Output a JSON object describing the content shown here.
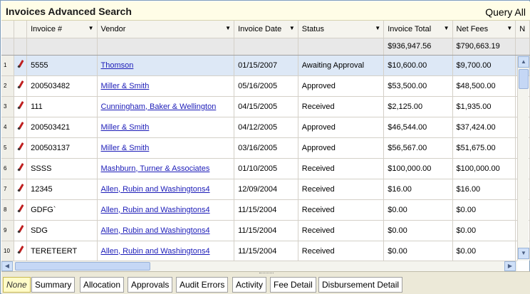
{
  "header": {
    "title": "Invoices Advanced Search",
    "query_all": "Query All"
  },
  "columns": [
    {
      "label": "Invoice #"
    },
    {
      "label": "Vendor"
    },
    {
      "label": "Invoice Date"
    },
    {
      "label": "Status"
    },
    {
      "label": "Invoice Total"
    },
    {
      "label": "Net Fees"
    },
    {
      "label": "N"
    }
  ],
  "totals": {
    "invoice_total": "$936,947.56",
    "net_fees": "$790,663.19"
  },
  "rows": [
    {
      "num": "1",
      "invoice": "5555",
      "vendor": "Thomson",
      "date": "01/15/2007",
      "status": "Awaiting Approval",
      "total": "$10,600.00",
      "fees": "$9,700.00"
    },
    {
      "num": "2",
      "invoice": "200503482",
      "vendor": "Miller & Smith",
      "date": "05/16/2005",
      "status": "Approved",
      "total": "$53,500.00",
      "fees": "$48,500.00"
    },
    {
      "num": "3",
      "invoice": "111",
      "vendor": "Cunningham, Baker & Wellington",
      "date": "04/15/2005",
      "status": "Received",
      "total": "$2,125.00",
      "fees": "$1,935.00"
    },
    {
      "num": "4",
      "invoice": "200503421",
      "vendor": "Miller & Smith",
      "date": "04/12/2005",
      "status": "Approved",
      "total": "$46,544.00",
      "fees": "$37,424.00"
    },
    {
      "num": "5",
      "invoice": "200503137",
      "vendor": "Miller & Smith",
      "date": "03/16/2005",
      "status": "Approved",
      "total": "$56,567.00",
      "fees": "$51,675.00"
    },
    {
      "num": "6",
      "invoice": "SSSS",
      "vendor": "Mashburn, Turner & Associates",
      "date": "01/10/2005",
      "status": "Received",
      "total": "$100,000.00",
      "fees": "$100,000.00"
    },
    {
      "num": "7",
      "invoice": "12345",
      "vendor": "Allen, Rubin and Washingtons4",
      "date": "12/09/2004",
      "status": "Received",
      "total": "$16.00",
      "fees": "$16.00"
    },
    {
      "num": "8",
      "invoice": "GDFG`",
      "vendor": "Allen, Rubin and Washingtons4",
      "date": "11/15/2004",
      "status": "Received",
      "total": "$0.00",
      "fees": "$0.00"
    },
    {
      "num": "9",
      "invoice": "SDG",
      "vendor": "Allen, Rubin and Washingtons4",
      "date": "11/15/2004",
      "status": "Received",
      "total": "$0.00",
      "fees": "$0.00"
    },
    {
      "num": "10",
      "invoice": "TERETEERT",
      "vendor": "Allen, Rubin and Washingtons4",
      "date": "11/15/2004",
      "status": "Received",
      "total": "$0.00",
      "fees": "$0.00"
    }
  ],
  "tabs": [
    {
      "label": "None"
    },
    {
      "label": "Summary"
    },
    {
      "label": "Allocation"
    },
    {
      "label": "Approvals"
    },
    {
      "label": "Audit Errors"
    },
    {
      "label": "Activity"
    },
    {
      "label": "Fee Detail"
    },
    {
      "label": "Disbursement Detail"
    }
  ],
  "scrollbar": {
    "up": "▲",
    "down": "▼",
    "left": "◀",
    "right": "▶",
    "sort_arrow": "▼"
  },
  "colors": {
    "header_bg": "#fffde7",
    "selected_row": "#dde8f6",
    "link": "#1c1cb8",
    "active_tab": "#fffbc8"
  }
}
